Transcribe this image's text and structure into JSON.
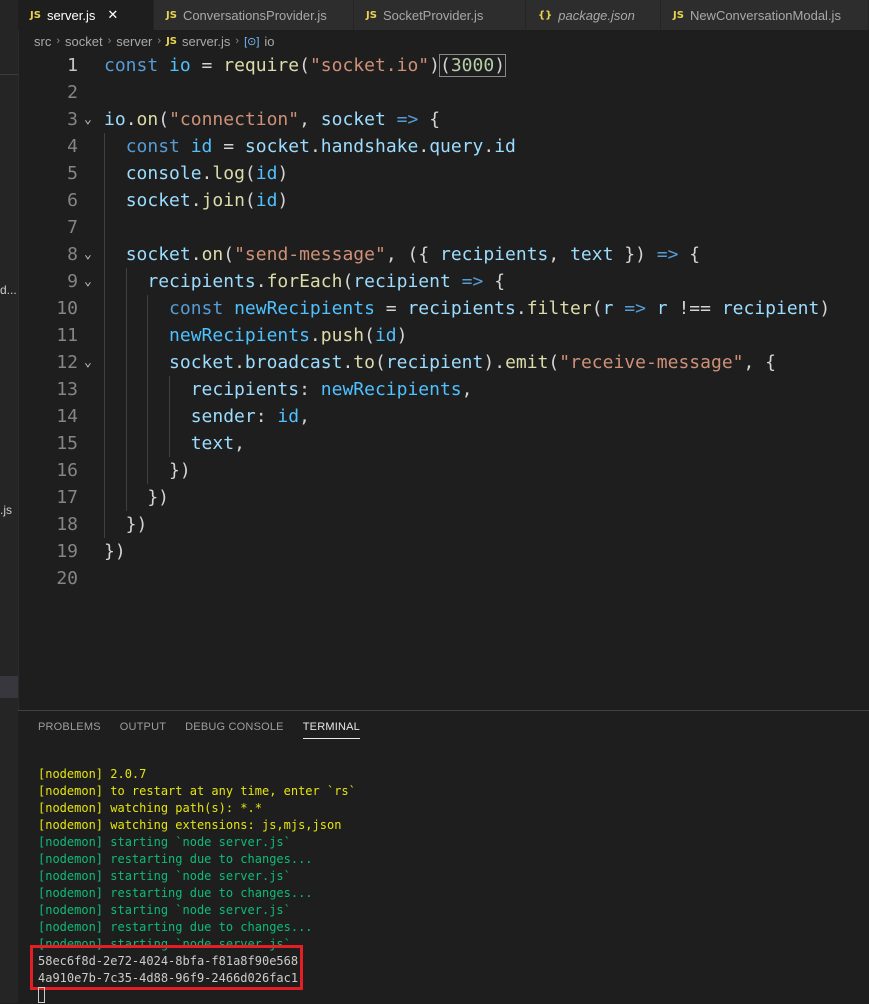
{
  "tabs": [
    {
      "icon": "JS",
      "label": "server.js",
      "active": true,
      "close": "✕"
    },
    {
      "icon": "JS",
      "label": "ConversationsProvider.js"
    },
    {
      "icon": "JS",
      "label": "SocketProvider.js"
    },
    {
      "icon": "{}",
      "label": "package.json"
    },
    {
      "icon": "JS",
      "label": "NewConversationModal.js"
    }
  ],
  "sidebar": {
    "frag1": "d...",
    "frag2": ".js"
  },
  "breadcrumb": [
    "src",
    "socket",
    "server",
    "server.js",
    "io"
  ],
  "code_lines": [
    {
      "n": "1",
      "html": "<span class=\"k\">const</span> <span class=\"c\">io</span> = <span class=\"f\">require</span>(<span class=\"s\">\"socket.io\"</span>)<span class=\"hl\">(<span class=\"n\">3000</span>)</span>"
    },
    {
      "n": "2",
      "html": ""
    },
    {
      "n": "3",
      "fold": true,
      "html": "<span class=\"v\">io</span>.<span class=\"f\">on</span>(<span class=\"s\">\"connection\"</span>, <span class=\"v\">socket</span> <span class=\"k\">=&gt;</span> {"
    },
    {
      "n": "4",
      "html": "  <span class=\"k\">const</span> <span class=\"c\">id</span> = <span class=\"v\">socket</span>.<span class=\"v\">handshake</span>.<span class=\"v\">query</span>.<span class=\"v\">id</span>"
    },
    {
      "n": "5",
      "html": "  <span class=\"v\">console</span>.<span class=\"f\">log</span>(<span class=\"c\">id</span>)"
    },
    {
      "n": "6",
      "html": "  <span class=\"v\">socket</span>.<span class=\"f\">join</span>(<span class=\"c\">id</span>)"
    },
    {
      "n": "7",
      "html": ""
    },
    {
      "n": "8",
      "fold": true,
      "html": "  <span class=\"v\">socket</span>.<span class=\"f\">on</span>(<span class=\"s\">\"send-message\"</span>, ({ <span class=\"v\">recipients</span>, <span class=\"v\">text</span> }) <span class=\"k\">=&gt;</span> {"
    },
    {
      "n": "9",
      "fold": true,
      "html": "    <span class=\"v\">recipients</span>.<span class=\"f\">forEach</span>(<span class=\"v\">recipient</span> <span class=\"k\">=&gt;</span> {"
    },
    {
      "n": "10",
      "html": "      <span class=\"k\">const</span> <span class=\"c\">newRecipients</span> = <span class=\"v\">recipients</span>.<span class=\"f\">filter</span>(<span class=\"v\">r</span> <span class=\"k\">=&gt;</span> <span class=\"v\">r</span> !== <span class=\"v\">recipient</span>)"
    },
    {
      "n": "11",
      "html": "      <span class=\"c\">newRecipients</span>.<span class=\"f\">push</span>(<span class=\"c\">id</span>)"
    },
    {
      "n": "12",
      "fold": true,
      "html": "      <span class=\"v\">socket</span>.<span class=\"v\">broadcast</span>.<span class=\"f\">to</span>(<span class=\"v\">recipient</span>).<span class=\"f\">emit</span>(<span class=\"s\">\"receive-message\"</span>, {"
    },
    {
      "n": "13",
      "html": "        <span class=\"v\">recipients</span>: <span class=\"c\">newRecipients</span>,"
    },
    {
      "n": "14",
      "html": "        <span class=\"v\">sender</span>: <span class=\"c\">id</span>,"
    },
    {
      "n": "15",
      "html": "        <span class=\"v\">text</span>,"
    },
    {
      "n": "16",
      "html": "      })"
    },
    {
      "n": "17",
      "html": "    })"
    },
    {
      "n": "18",
      "html": "  })"
    },
    {
      "n": "19",
      "html": "})"
    },
    {
      "n": "20",
      "html": ""
    }
  ],
  "panel_tabs": [
    {
      "label": "PROBLEMS"
    },
    {
      "label": "OUTPUT"
    },
    {
      "label": "DEBUG CONSOLE"
    },
    {
      "label": "TERMINAL",
      "active": true
    }
  ],
  "terminal_lines": [
    {
      "text": "[nodemon] 2.0.7",
      "color": "yellow"
    },
    {
      "text": "[nodemon] to restart at any time, enter `rs`",
      "color": "yellow"
    },
    {
      "text": "[nodemon] watching path(s): *.*",
      "color": "yellow"
    },
    {
      "text": "[nodemon] watching extensions: js,mjs,json",
      "color": "yellow"
    },
    {
      "text": "[nodemon] starting `node server.js`",
      "color": "green"
    },
    {
      "text": "[nodemon] restarting due to changes...",
      "color": "green"
    },
    {
      "text": "[nodemon] starting `node server.js`",
      "color": "green"
    },
    {
      "text": "[nodemon] restarting due to changes...",
      "color": "green"
    },
    {
      "text": "[nodemon] starting `node server.js`",
      "color": "green"
    },
    {
      "text": "[nodemon] restarting due to changes...",
      "color": "green"
    },
    {
      "text": "[nodemon] starting `node server.js`",
      "color": "green"
    },
    {
      "text": "58ec6f8d-2e72-4024-8bfa-f81a8f90e568",
      "color": "white"
    },
    {
      "text": "4a910e7b-7c35-4d88-96f9-2466d026fac1",
      "color": "white"
    }
  ],
  "colors": {
    "highlight_box": "#e31e24",
    "accent": "#007acc"
  }
}
